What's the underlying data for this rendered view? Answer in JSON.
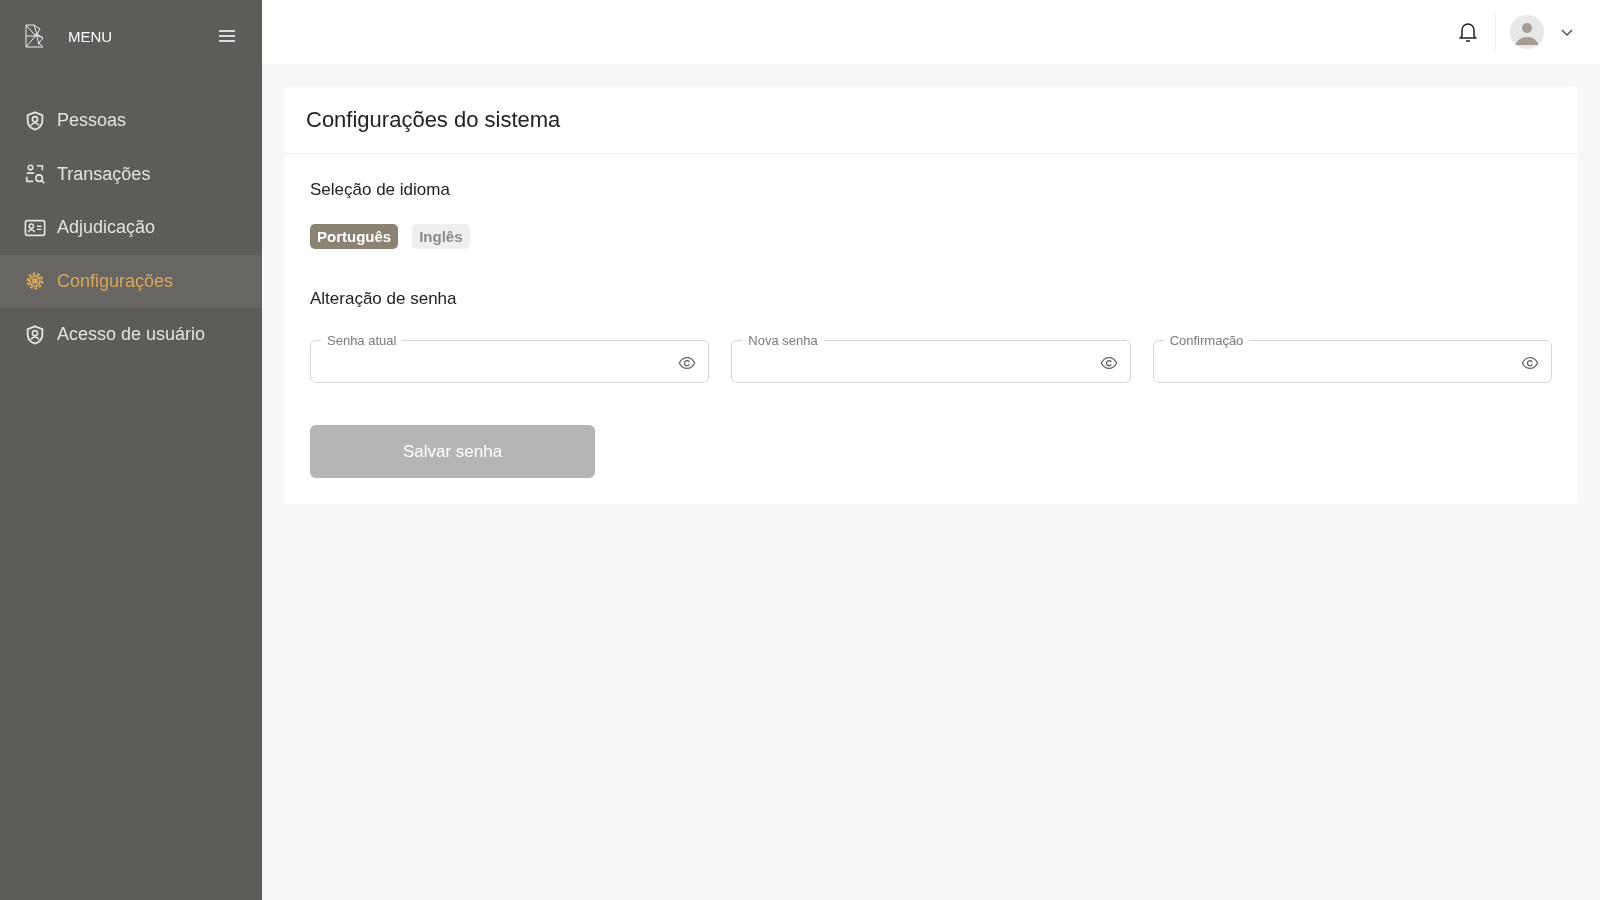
{
  "sidebar": {
    "title": "MENU",
    "items": [
      {
        "label": "Pessoas",
        "kind": "shield-user",
        "selected": false
      },
      {
        "label": "Transações",
        "kind": "user-search",
        "selected": false
      },
      {
        "label": "Adjudicação",
        "kind": "id-card",
        "selected": false
      },
      {
        "label": "Configurações",
        "kind": "gear",
        "selected": true
      },
      {
        "label": "Acesso de usuário",
        "kind": "shield-user",
        "selected": false
      }
    ]
  },
  "page": {
    "title": "Configurações do sistema",
    "language": {
      "heading": "Seleção de idioma",
      "options": [
        {
          "label": "Português",
          "selected": true
        },
        {
          "label": "Inglês",
          "selected": false
        }
      ]
    },
    "password": {
      "heading": "Alteração de senha",
      "fields": [
        {
          "label": "Senha atual"
        },
        {
          "label": "Nova senha"
        },
        {
          "label": "Confirmação"
        }
      ],
      "button": {
        "label": "Salvar senha",
        "disabled": true
      }
    }
  }
}
